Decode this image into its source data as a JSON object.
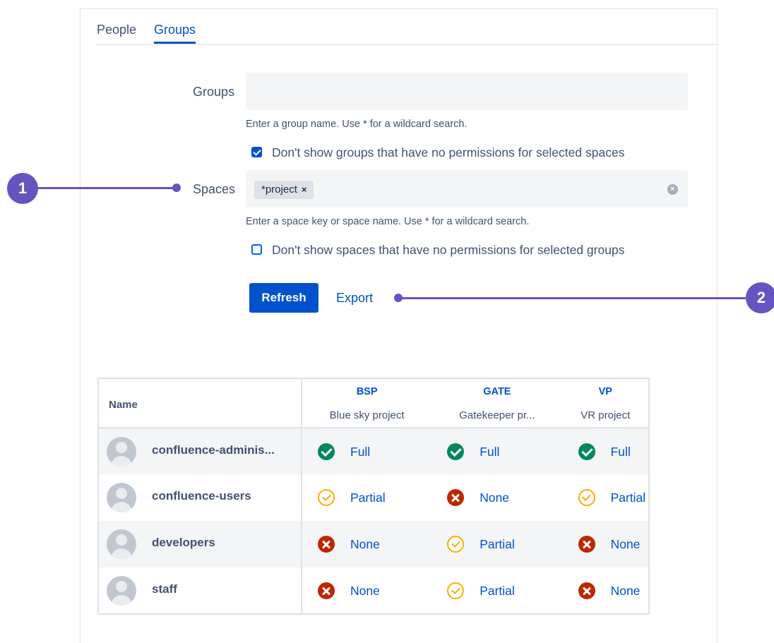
{
  "tabs": [
    {
      "label": "People",
      "active": false
    },
    {
      "label": "Groups",
      "active": true
    }
  ],
  "filters": {
    "groups": {
      "label": "Groups",
      "value": "",
      "help": "Enter a group name. Use * for a wildcard search.",
      "checkbox_label": "Don't show groups that have no permissions for selected spaces",
      "checkbox_checked": true
    },
    "spaces": {
      "label": "Spaces",
      "tag": "*project",
      "tag_remove": "×",
      "help": "Enter a space key or space name. Use * for a wildcard search.",
      "checkbox_label": "Don't show spaces that have no permissions for selected groups",
      "checkbox_checked": false
    }
  },
  "actions": {
    "refresh_label": "Refresh",
    "export_label": "Export"
  },
  "callouts": [
    "1",
    "2"
  ],
  "table": {
    "name_header": "Name",
    "spaces": [
      {
        "key": "BSP",
        "name": "Blue sky project"
      },
      {
        "key": "GATE",
        "name": "Gatekeeper pr..."
      },
      {
        "key": "VP",
        "name": "VR project"
      }
    ],
    "rows": [
      {
        "group": "confluence-adminis...",
        "perms": [
          {
            "status": "full",
            "label": "Full"
          },
          {
            "status": "full",
            "label": "Full"
          },
          {
            "status": "full",
            "label": "Full"
          }
        ]
      },
      {
        "group": "confluence-users",
        "perms": [
          {
            "status": "partial",
            "label": "Partial"
          },
          {
            "status": "none",
            "label": "None"
          },
          {
            "status": "partial",
            "label": "Partial"
          }
        ]
      },
      {
        "group": "developers",
        "perms": [
          {
            "status": "none",
            "label": "None"
          },
          {
            "status": "partial",
            "label": "Partial"
          },
          {
            "status": "none",
            "label": "None"
          }
        ]
      },
      {
        "group": "staff",
        "perms": [
          {
            "status": "none",
            "label": "None"
          },
          {
            "status": "partial",
            "label": "Partial"
          },
          {
            "status": "none",
            "label": "None"
          }
        ]
      }
    ]
  },
  "colors": {
    "accent": "#0052cc",
    "callout": "#6554c0",
    "full": "#00875a",
    "none": "#bf2600",
    "partial": "#ffab00"
  }
}
